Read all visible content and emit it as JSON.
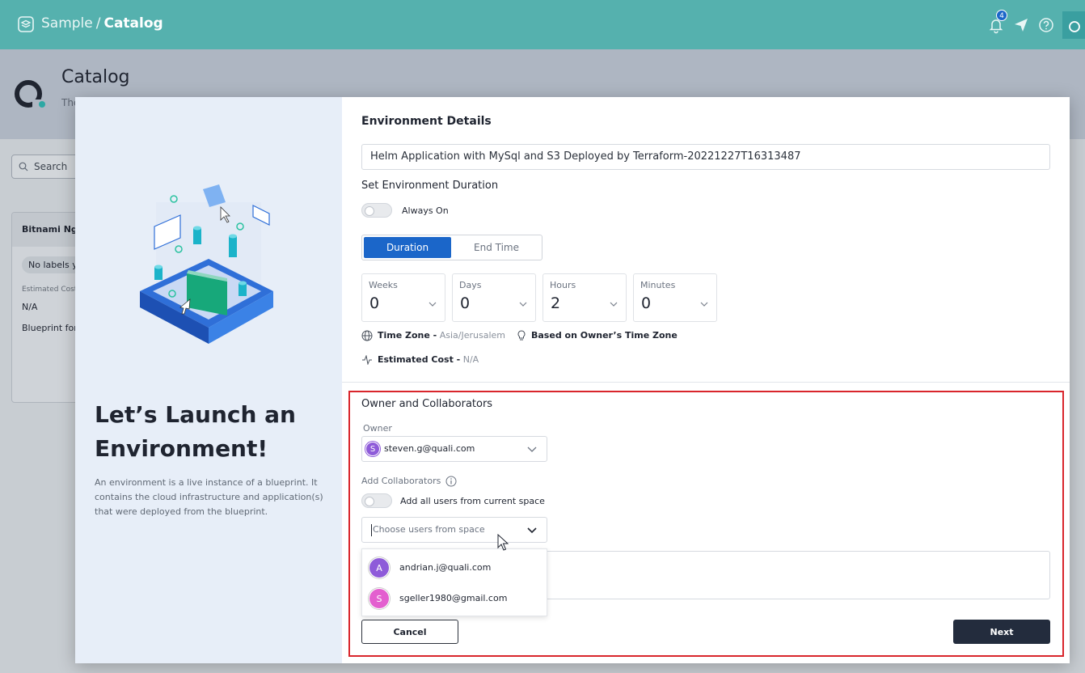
{
  "topbar": {
    "space": "Sample",
    "separator": "/",
    "page": "Catalog",
    "notification_count": "4",
    "colors": {
      "background": "#55b1ae"
    }
  },
  "background_page": {
    "title": "Catalog",
    "description": "The you",
    "search_placeholder": "Search",
    "card": {
      "title": "Bitnami Ngi",
      "labels_chip": "No labels y",
      "estimated_cost_label": "Estimated Cost",
      "estimated_cost_value": "N/A",
      "blueprint_text": "Blueprint for"
    }
  },
  "modal": {
    "left": {
      "title": "Let’s Launch an Environment!",
      "description": "An environment is a live instance of a blueprint. It contains the cloud infrastructure and application(s) that were deployed from the blueprint."
    },
    "details": {
      "section_title": "Environment Details",
      "env_name": "Helm Application with MySql and S3 Deployed by Terraform-20221227T16313487",
      "duration_title": "Set Environment Duration",
      "always_on_label": "Always On",
      "tabs": [
        "Duration",
        "End Time"
      ],
      "duration": [
        {
          "label": "Weeks",
          "value": "0"
        },
        {
          "label": "Days",
          "value": "0"
        },
        {
          "label": "Hours",
          "value": "2"
        },
        {
          "label": "Minutes",
          "value": "0"
        }
      ],
      "timezone_label": "Time Zone -",
      "timezone_value": "Asia/Jerusalem",
      "owner_tz_label": "Based on Owner’s Time Zone",
      "estimated_cost_label": "Estimated Cost -",
      "estimated_cost_value": "N/A"
    },
    "owners": {
      "section_title": "Owner and Collaborators",
      "owner_label": "Owner",
      "owner_value": "steven.g@quali.com",
      "owner_initial": "S",
      "collaborators_label": "Add Collaborators",
      "add_all_label": "Add all users from current space",
      "choose_placeholder": "Choose users from space",
      "options": [
        {
          "initial": "A",
          "email": "andrian.j@quali.com",
          "color": "#8e5bd9"
        },
        {
          "initial": "S",
          "email": "sgeller1980@gmail.com",
          "color": "#e35fcf"
        }
      ]
    },
    "buttons": {
      "cancel": "Cancel",
      "next": "Next"
    }
  },
  "colors": {
    "primary": "#1b66c9",
    "dark_button": "#232c3d",
    "highlight": "#d9262c"
  }
}
